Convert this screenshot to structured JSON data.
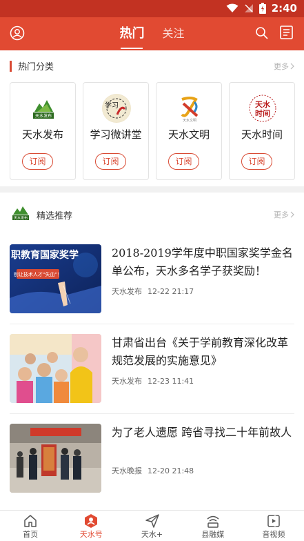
{
  "status_bar": {
    "time": "2:40"
  },
  "header": {
    "tabs": [
      {
        "label": "热门",
        "active": true
      },
      {
        "label": "关注",
        "active": false
      }
    ]
  },
  "hot_categories": {
    "title": "热门分类",
    "more": "更多",
    "items": [
      {
        "name": "天水发布",
        "subscribe": "订阅",
        "icon": "tianshui-fabu-logo",
        "logo_text": "天水发布"
      },
      {
        "name": "学习微讲堂",
        "subscribe": "订阅",
        "icon": "study-lecture-logo",
        "logo_text": "学习"
      },
      {
        "name": "天水文明",
        "subscribe": "订阅",
        "icon": "tianshui-civilization-logo",
        "logo_text": "天水文明"
      },
      {
        "name": "天水时间",
        "subscribe": "订阅",
        "icon": "tianshui-time-logo",
        "logo_text": "天水时间"
      }
    ]
  },
  "recommended": {
    "title": "精选推荐",
    "more": "更多",
    "logo_text": "天水发布",
    "items": [
      {
        "title": "2018-2019学年度中职国家奖学金名单公布，天水多名学子获奖励！",
        "source": "天水发布",
        "time": "12-22 21:17",
        "image": "scholarship-banner",
        "image_text": "职教育国家奖学",
        "image_subtext": "别让技术人才“失血”！"
      },
      {
        "title": "甘肃省出台《关于学前教育深化改革规范发展的实施意见》",
        "source": "天水发布",
        "time": "12-23 11:41",
        "image": "kindergarten-children-photo"
      },
      {
        "title": "为了老人遗愿  跨省寻找二十年前故人",
        "source": "天水晚报",
        "time": "12-20 21:48",
        "image": "police-banner-photo"
      }
    ]
  },
  "bottom_nav": [
    {
      "label": "首页",
      "icon": "home-icon",
      "active": false
    },
    {
      "label": "天水号",
      "icon": "tianshui-hao-icon",
      "active": true
    },
    {
      "label": "天水+",
      "icon": "send-icon",
      "active": false
    },
    {
      "label": "县融媒",
      "icon": "broadcast-icon",
      "active": false
    },
    {
      "label": "音视频",
      "icon": "video-icon",
      "active": false
    }
  ],
  "colors": {
    "brand": "#e14a32",
    "status_bar": "#c23222"
  }
}
